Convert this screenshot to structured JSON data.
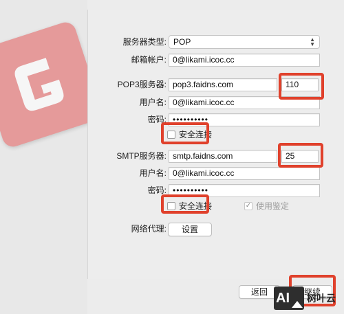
{
  "form": {
    "server_type": {
      "label": "服务器类型:",
      "value": "POP"
    },
    "email_account": {
      "label": "邮箱帐户:",
      "value": "0@likami.icoc.cc"
    },
    "pop3": {
      "server_label": "POP3服务器:",
      "server_value": "pop3.faidns.com",
      "port_value": "110",
      "username_label": "用户名:",
      "username_value": "0@likami.icoc.cc",
      "password_label": "密码:",
      "password_value": "••••••••••",
      "secure_label": "安全连接"
    },
    "smtp": {
      "server_label": "SMTP服务器:",
      "server_value": "smtp.faidns.com",
      "port_value": "25",
      "username_label": "用户名:",
      "username_value": "0@likami.icoc.cc",
      "password_label": "密码:",
      "password_value": "••••••••••",
      "secure_label": "安全连接",
      "use_auth_label": "使用鉴定",
      "use_auth_checked": "✓"
    },
    "proxy": {
      "label": "网络代理:",
      "button_label": "设置"
    }
  },
  "footer": {
    "back_label": "返回",
    "next_label": "继续"
  },
  "watermark": {
    "badge": "AI",
    "text": "树叶云"
  },
  "colors": {
    "highlight": "#e0412c",
    "logo_tile": "#e59a9a"
  }
}
